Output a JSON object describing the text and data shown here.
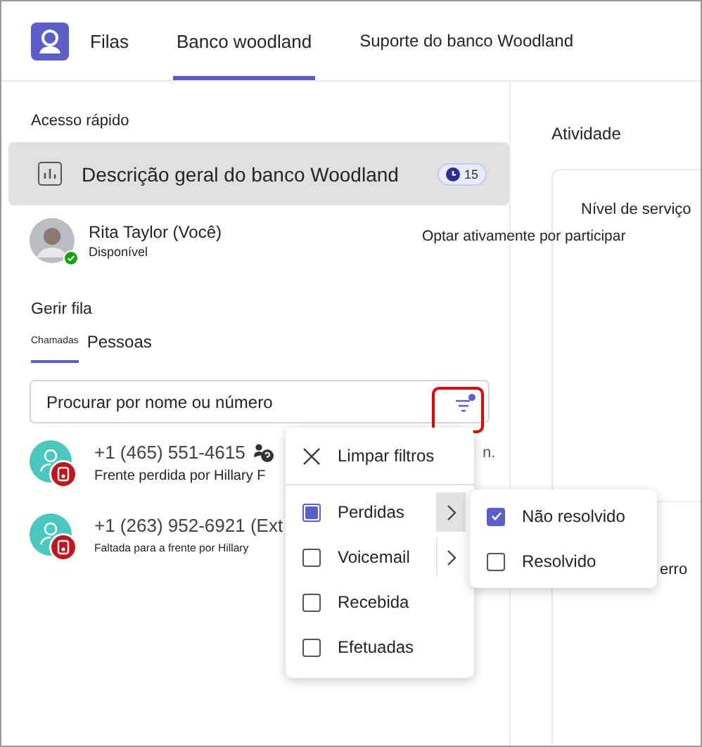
{
  "header": {
    "app": "Filas",
    "tabs": [
      {
        "label": "Banco woodland",
        "selected": true
      },
      {
        "label": "Suporte do banco Woodland",
        "selected": false
      }
    ]
  },
  "quick_access": {
    "title": "Acesso rápido",
    "item": {
      "label": "Descrição geral do banco Woodland",
      "badge": "15",
      "selected": true
    }
  },
  "user": {
    "name": "Rita Taylor (Você)",
    "status": "Disponível",
    "opt_in": "Optar ativamente por participar"
  },
  "queue": {
    "title": "Gerir fila",
    "tabs": [
      {
        "label": "Chamadas",
        "selected": true
      },
      {
        "label": "Pessoas",
        "selected": false
      }
    ],
    "search": {
      "placeholder": "Procurar por nome ou número"
    },
    "calls": [
      {
        "number": "+1 (465) 551-4615",
        "detail": "Frente perdida por Hillary F",
        "time": "n."
      },
      {
        "number": "+1 (263) 952-6921 (Ext",
        "detail": "Faltada para a frente por Hillary"
      }
    ]
  },
  "activity": {
    "title": "Atividade",
    "card_title": "Nível de serviço",
    "fragment": "erro"
  },
  "filter_menu": {
    "clear": "Limpar filtros",
    "items": [
      {
        "label": "Perdidas",
        "checked": false,
        "mixed": true,
        "submenu": true,
        "expanded": true
      },
      {
        "label": "Voicemail",
        "checked": false,
        "mixed": false,
        "submenu": true,
        "expanded": false
      },
      {
        "label": "Recebida",
        "checked": false,
        "mixed": false,
        "submenu": false
      },
      {
        "label": "Efetuadas",
        "checked": false,
        "mixed": false,
        "submenu": false
      }
    ]
  },
  "submenu": {
    "items": [
      {
        "label": "Não resolvido",
        "checked": true
      },
      {
        "label": "Resolvido",
        "checked": false
      }
    ]
  }
}
